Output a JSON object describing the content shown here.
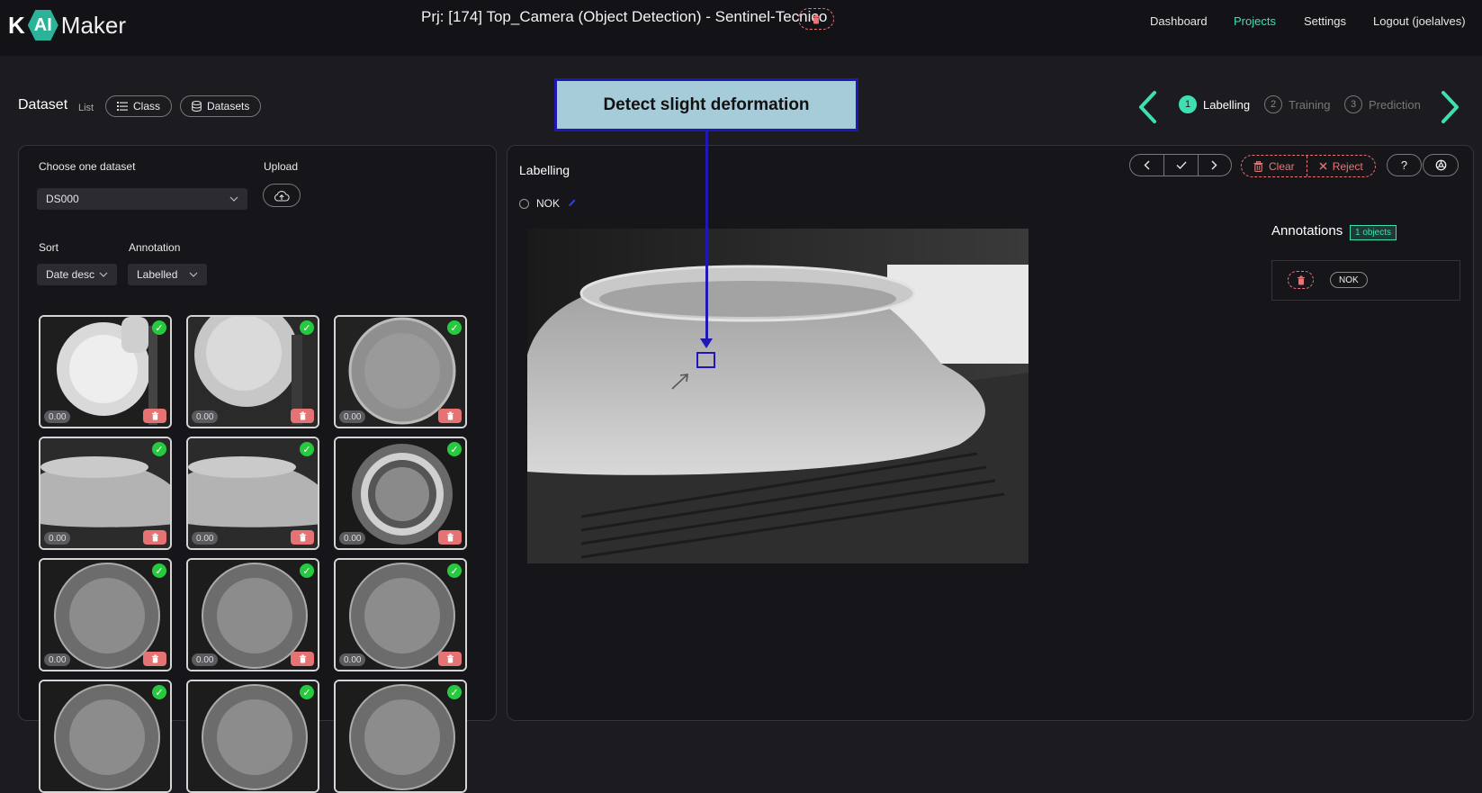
{
  "app": {
    "logo_k": "K",
    "logo_ai": "AI",
    "logo_maker": "Maker",
    "project_title": "Prj: [174] Top_Camera (Object Detection) - Sentinel-Tecnico",
    "nav": [
      {
        "label": "Dashboard",
        "active": false
      },
      {
        "label": "Projects",
        "active": true
      },
      {
        "label": "Settings",
        "active": false
      },
      {
        "label": "Logout (joelalves)",
        "active": false
      }
    ]
  },
  "dataset_header": {
    "title": "Dataset",
    "list_label": "List",
    "class_btn": "Class",
    "datasets_btn": "Datasets"
  },
  "annotation_callout": {
    "text": "Detect slight deformation"
  },
  "steps": [
    {
      "num": "1",
      "label": "Labelling",
      "active": true
    },
    {
      "num": "2",
      "label": "Training",
      "active": false
    },
    {
      "num": "3",
      "label": "Prediction",
      "active": false
    }
  ],
  "left_panel": {
    "choose_label": "Choose one dataset",
    "dataset_value": "DS000",
    "upload_label": "Upload",
    "sort_label": "Sort",
    "sort_value": "Date desc",
    "annotation_label": "Annotation",
    "annotation_value": "Labelled",
    "thumbnails": [
      {
        "score": "0.00",
        "variant": "plate-hand"
      },
      {
        "score": "0.00",
        "variant": "plate-light"
      },
      {
        "score": "0.00",
        "variant": "plate-dark"
      },
      {
        "score": "0.00",
        "variant": "bowl"
      },
      {
        "score": "0.00",
        "variant": "bowl"
      },
      {
        "score": "0.00",
        "variant": "plate-ring"
      },
      {
        "score": "0.00",
        "variant": "plate-mid"
      },
      {
        "score": "0.00",
        "variant": "plate-mid"
      },
      {
        "score": "0.00",
        "variant": "plate-mid"
      },
      {
        "score": "",
        "variant": "plate-mid"
      },
      {
        "score": "",
        "variant": "plate-mid"
      },
      {
        "score": "",
        "variant": "plate-mid"
      }
    ]
  },
  "labelling": {
    "title": "Labelling",
    "clear_label": "Clear",
    "reject_label": "Reject",
    "help_label": "?",
    "class_name": "NOK"
  },
  "annotations": {
    "title": "Annotations",
    "count_badge": "1 objects",
    "items": [
      {
        "class": "NOK"
      }
    ]
  },
  "colors": {
    "accent": "#3ee0b2",
    "danger": "#e87575",
    "callout_bg": "#a6cbd9",
    "callout_border": "#1f18b5",
    "check": "#27c93f"
  }
}
